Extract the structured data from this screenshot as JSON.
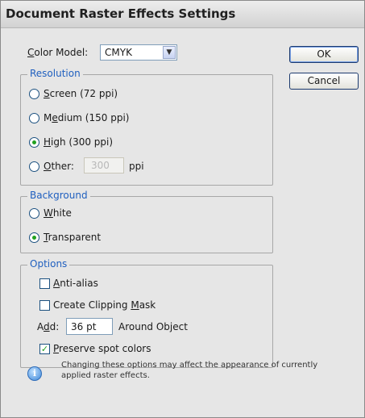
{
  "dialog": {
    "title": "Document Raster Effects Settings"
  },
  "color_model": {
    "label_prefix": "",
    "label_underlined": "C",
    "label_rest": "olor Model:",
    "value": "CMYK"
  },
  "buttons": {
    "ok": "OK",
    "cancel": "Cancel"
  },
  "resolution": {
    "legend": "Resolution",
    "options": [
      {
        "u": "S",
        "rest": "creen (72 ppi)",
        "selected": false
      },
      {
        "pre": "M",
        "u": "e",
        "rest": "dium (150 ppi)",
        "selected": false
      },
      {
        "u": "H",
        "rest": "igh (300 ppi)",
        "selected": true
      },
      {
        "u": "O",
        "rest": "ther:",
        "selected": false
      }
    ],
    "other_value": "300",
    "other_unit": "ppi"
  },
  "background": {
    "legend": "Background",
    "options": [
      {
        "u": "W",
        "rest": "hite",
        "selected": false
      },
      {
        "u": "T",
        "rest": "ransparent",
        "selected": true
      }
    ]
  },
  "options": {
    "legend": "Options",
    "anti_alias": {
      "u": "A",
      "rest": "nti-alias",
      "checked": false
    },
    "clipping_mask": {
      "pre": "Create Clipping ",
      "u": "M",
      "rest": "ask",
      "checked": false
    },
    "add_label_pre": "A",
    "add_label_u": "d",
    "add_label_rest": "d:",
    "add_value": "36 pt",
    "add_suffix": "Around Object",
    "preserve_spot": {
      "u": "P",
      "rest": "reserve spot colors",
      "checked": true
    }
  },
  "info": {
    "icon": "info-icon",
    "text": "Changing these options may affect the appearance of currently applied raster effects."
  }
}
